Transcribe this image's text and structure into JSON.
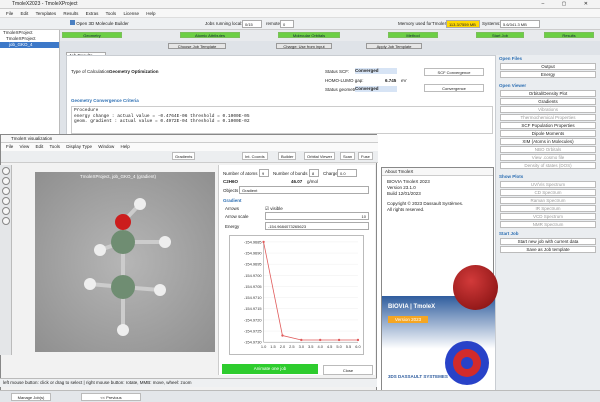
{
  "app": {
    "title": "TmoleX2023 - TmoleXProject",
    "win_controls": "– ▢ ✕"
  },
  "menu": [
    "File",
    "Edit",
    "Templates",
    "Results",
    "Extras",
    "Tools",
    "License",
    "Help"
  ],
  "toolbar": {
    "open3d": "Open 3D Molecule Builder",
    "jobs_running": "Jobs running",
    "jobs_local": "local:",
    "jobs_local_val": "0/15",
    "jobs_remote": "remote:",
    "jobs_remote_val": "0",
    "memory": "Memory used for",
    "tmolex": "TmoleX:",
    "mem_val": "113.3/7559 MB",
    "systems": "Systems:",
    "sys_val": "5.6/341.3 MB"
  },
  "workflow": {
    "steps": [
      "Geometry",
      "Atomic Attributes",
      "Molecular Orbitals",
      "Method",
      "Start Job",
      "Results"
    ],
    "sub": [
      "Choose Job Template",
      "Charge: Use from input",
      "Apply Job Template"
    ]
  },
  "tree": {
    "items": [
      "TmoleXProject",
      "TmoleXProject",
      "job_GKO_4"
    ]
  },
  "results": {
    "tab": "Job Results",
    "calc_label": "Type of Calculation:",
    "calc_value": "Geometry Optimization",
    "status_scf_label": "Status SCF:",
    "status_scf": "Converged",
    "homo_lumo_label": "HOMO-LUMO gap:",
    "homo_lumo": "6.745",
    "homo_unit": "eV",
    "status_geo_label": "Status geometry:",
    "status_geo": "Converged",
    "scf_btn": "SCF Convergence",
    "conv_btn": "Convergence",
    "crit_title": "Geometry Convergence Criteria",
    "crit_lines": [
      "Procedure",
      "energy change  : actual value = -0.4764E-06 threshold =   0.1000E-05",
      "geom. gradient : actual value =  0.4972E-04 threshold =   0.1000E-02"
    ]
  },
  "right": {
    "open_files": "Open Files",
    "output": "Output",
    "energy": "Energy",
    "open_viewer": "Open Viewer",
    "viewer_btns": [
      "Orbital/Density Plot",
      "Gradients",
      "Vibrations",
      "Thermochemical Properties",
      "SCF Population Properties",
      "Dipole Moments",
      "XIM (Atoms in Molecules)",
      "NBO Orbitals",
      "View .cosmo file",
      "Density of states (DOS)"
    ],
    "show_plots": "Show Plots",
    "plot_btns": [
      "UV/Vis Spectrum",
      "CD Spectrum",
      "Raman Spectrum",
      "IR Spectrum",
      "VCD Spectrum",
      "NMR Spectrum"
    ],
    "start_job": "Start Job",
    "start_new": "Start new job with current data",
    "save_tpl": "Save as Job template"
  },
  "viz": {
    "title": "TmoleX visualization",
    "menu": [
      "File",
      "View",
      "Edit",
      "Tools",
      "Display Type",
      "Window",
      "Help"
    ],
    "tools": [
      "Gradients",
      "Int. Coords",
      "Builder",
      "Orbital Viewer",
      "Scan",
      "Fuse"
    ],
    "mol_title": "TmoleXProject, job_GKO_4 (gradient)",
    "num_atoms_label": "Number of atoms",
    "num_atoms": "9",
    "num_bonds_label": "Number of bonds",
    "num_bonds": "8",
    "charge_label": "Charge",
    "charge": "0.0",
    "formula": "C2H6O",
    "mass": "46.07",
    "mass_unit": "g/mol",
    "objects_label": "Objects",
    "objects_val": "Gradient",
    "grad_head": "Gradient",
    "arrows": "Arrows",
    "visible": "visible",
    "arrow_scale": "Arrow scale",
    "arrow_scale_val": "10",
    "energy_label": "Energy",
    "energy_val": "-154.9684073265623",
    "ytick": [
      "-154.9730",
      "-154.9725",
      "-154.9720",
      "-154.9715",
      "-154.9710",
      "-154.9705",
      "-154.9700",
      "-154.9695",
      "-154.9690",
      "-154.9685"
    ],
    "xtick": [
      "1.0",
      "1.5",
      "2.0",
      "2.5",
      "3.0",
      "3.5",
      "4.0",
      "4.5",
      "5.0",
      "5.5",
      "6.0"
    ],
    "animate": "Animate one job",
    "close": "Close",
    "status": "left mouse button: click or drag to select | right mouse button: rotate, MMB: move, wheel: zoom"
  },
  "about": {
    "title": "About TmoleX",
    "product": "BIOVIA TmoleX 2023",
    "version": "Version 23.1.0",
    "build": "Build 12/01/2023",
    "copyright": "Copyright © 2023 Dassault Systèmes.",
    "rights": "All rights reserved.",
    "brand": "BIOVIA | TmoleX",
    "brand_sub": "Version 2023",
    "ds": "3DS DASSAULT SYSTEMES"
  },
  "bottom": {
    "manage": "Manage Job(s)",
    "previous": "<< Previous"
  },
  "chart_data": {
    "type": "line",
    "title": "",
    "xlabel": "",
    "ylabel": "",
    "x": [
      1,
      2,
      3,
      4,
      5,
      6
    ],
    "values": [
      -154.9685,
      -154.9727,
      -154.9729,
      -154.9729,
      -154.9729,
      -154.9729
    ],
    "ylim": [
      -154.973,
      -154.9685
    ],
    "xlim": [
      1,
      6
    ]
  }
}
